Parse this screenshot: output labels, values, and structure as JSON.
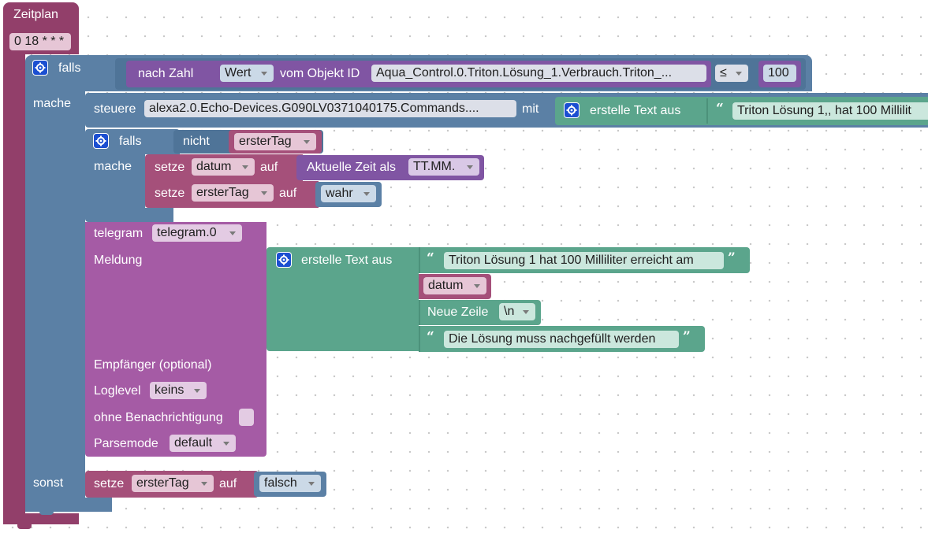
{
  "schedule": {
    "title": "Zeitplan",
    "cron": "0 18 * * *"
  },
  "if_block": {
    "falls_label": "falls",
    "mache_label": "mache",
    "sonst_label": "sonst"
  },
  "condition": {
    "to_number_label": "nach Zahl",
    "value_dropdown": "Wert",
    "of_object_label": "vom Objekt ID",
    "object_id": "Aqua_Control.0.Triton.Lösung_1.Verbrauch.Triton_...",
    "operator": "≤",
    "compare_value": "100"
  },
  "control": {
    "label": "steuere",
    "device": "alexa2.0.Echo-Devices.G090LV0371040175.Commands....",
    "with_label": "mit",
    "create_text_label": "erstelle Text aus",
    "text": "Triton Lösung 1,, hat 100 Millilit"
  },
  "inner_if": {
    "falls_label": "falls",
    "not_label": "nicht",
    "variable": "ersterTag",
    "mache_label": "mache"
  },
  "set_datum": {
    "label": "setze",
    "variable": "datum",
    "to_label": "auf",
    "time_label": "Aktuelle Zeit als",
    "format": "TT.MM."
  },
  "set_ersterTag_true": {
    "label": "setze",
    "variable": "ersterTag",
    "to_label": "auf",
    "value": "wahr"
  },
  "telegram": {
    "label": "telegram",
    "instance": "telegram.0",
    "message_label": "Meldung",
    "recipient_label": "Empfänger (optional)",
    "loglevel_label": "Loglevel",
    "loglevel_value": "keins",
    "silent_label": "ohne Benachrichtigung",
    "parsemode_label": "Parsemode",
    "parsemode_value": "default"
  },
  "message_text": {
    "create_text_label": "erstelle Text aus",
    "line1": "Triton Lösung 1 hat 100 Milliliter erreicht am",
    "datum_var": "datum",
    "newline_label": "Neue Zeile",
    "newline_value": "\\n",
    "line2": "Die Lösung muss nachgefüllt werden"
  },
  "else_set": {
    "label": "setze",
    "variable": "ersterTag",
    "to_label": "auf",
    "value": "falsch"
  },
  "colors": {
    "schedule": "#a5507a",
    "logic": "#5b80a5",
    "text": "#5ba58c",
    "telegram": "#a55ba5",
    "purple": "#8055a3"
  }
}
